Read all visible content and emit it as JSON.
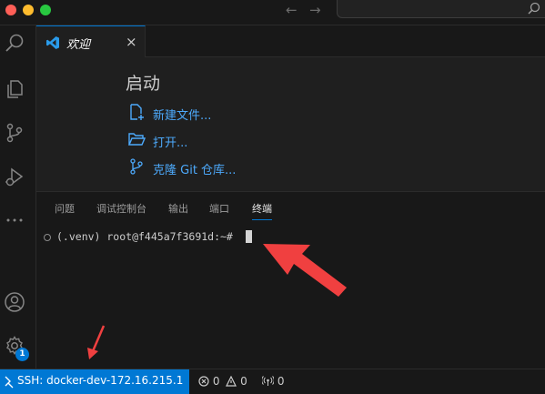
{
  "titlebar": {
    "traffic_lights": {
      "close": "#ff5f57",
      "minimize": "#febc2e",
      "zoom": "#28c840"
    },
    "back_icon": "←",
    "forward_icon": "→"
  },
  "activity_bar": {
    "items": [
      "search-icon",
      "explorer-icon",
      "source-control-icon",
      "run-debug-icon",
      "more-icon"
    ],
    "bottom": [
      "account-icon",
      "settings-gear-icon"
    ],
    "settings_badge": "1"
  },
  "editor": {
    "tabs": [
      {
        "label": "欢迎",
        "close": "×"
      }
    ]
  },
  "welcome": {
    "start_title": "启动",
    "start_items": [
      "新建文件...",
      "打开...",
      "克隆 Git 仓库..."
    ]
  },
  "panel": {
    "tabs": [
      "问题",
      "调试控制台",
      "输出",
      "端口",
      "终端"
    ],
    "active_tab": "终端",
    "terminal_prompt": "(.venv) root@f445a7f3691d:~# "
  },
  "statusbar": {
    "remote": "SSH: docker-dev-172.16.215.1",
    "errors": "0",
    "warnings": "0",
    "ports": "0"
  },
  "colors": {
    "accent": "#0078d4",
    "link": "#4daafc",
    "annotation_arrow": "#f04040"
  }
}
